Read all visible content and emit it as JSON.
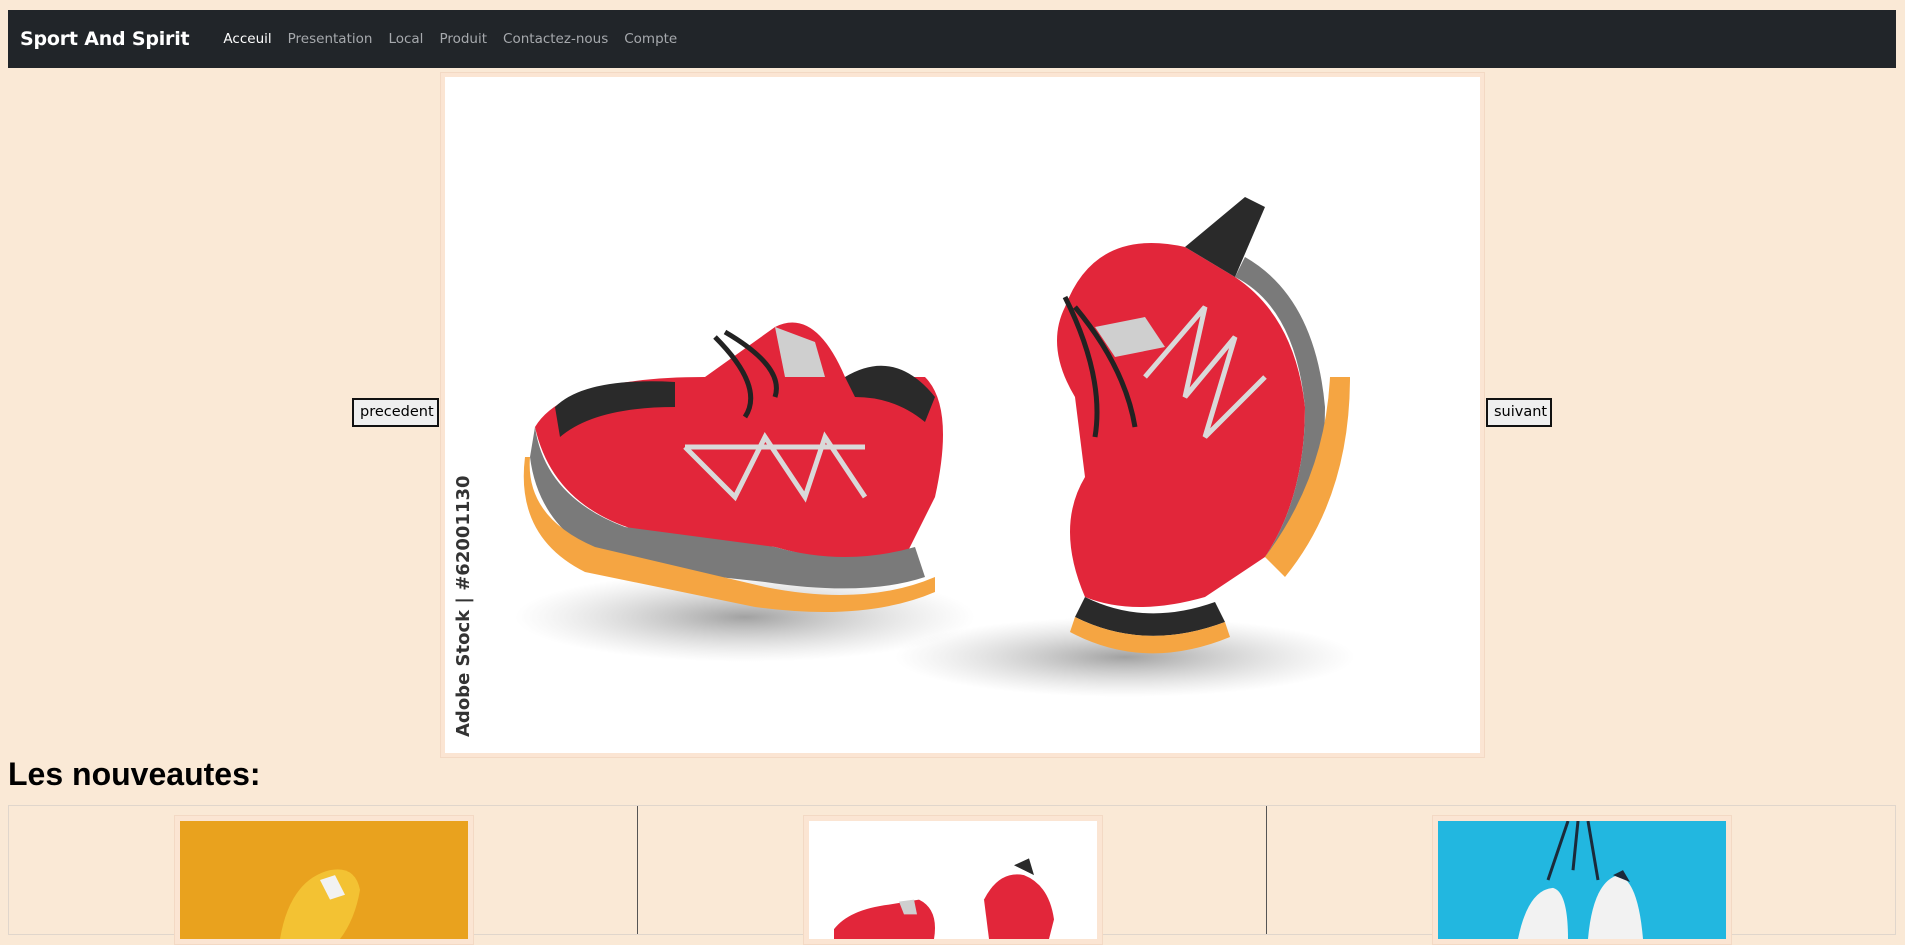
{
  "navbar": {
    "brand": "Sport And Spirit",
    "links": [
      "Acceuil",
      "Presentation",
      "Local",
      "Produit",
      "Contactez-nous",
      "Compte"
    ],
    "active_index": 0
  },
  "carousel": {
    "prev_label": "precedent",
    "next_label": "suivant",
    "image_caption": "Adobe Stock | #62001130"
  },
  "section": {
    "title": "Les nouveautes:"
  },
  "colors": {
    "page_bg": "#fae9d6",
    "navbar_bg": "#212529",
    "shoe_red": "#e2263a",
    "sole_orange": "#f5a542",
    "thumb_yellow": "#e9a21e",
    "thumb_blue": "#22b7e0"
  }
}
